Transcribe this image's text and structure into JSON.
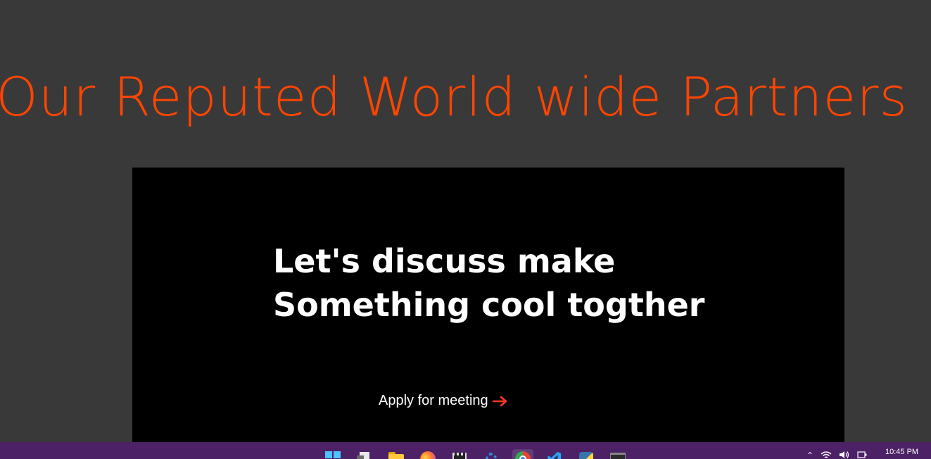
{
  "main": {
    "heading": "Our Reputed World wide Partners",
    "cta": {
      "title_line1": "Let's discuss make",
      "title_line2": "Something cool togther",
      "link_label": "Apply for meeting"
    }
  },
  "taskbar": {
    "apps": [
      "start-icon",
      "task-view-icon",
      "file-explorer-icon",
      "firefox-icon",
      "media-player-icon",
      "settings-icon",
      "chrome-icon",
      "vscode-icon",
      "python-icon",
      "terminal-icon"
    ],
    "active_app": "chrome-icon",
    "tray": [
      "chevron-up-icon",
      "wifi-icon",
      "volume-icon",
      "battery-icon"
    ],
    "clock": "10:45 PM"
  },
  "colors": {
    "page_bg": "#393939",
    "accent": "#ff4500",
    "panel_bg": "#000000",
    "taskbar_bg": "#4c2165"
  }
}
